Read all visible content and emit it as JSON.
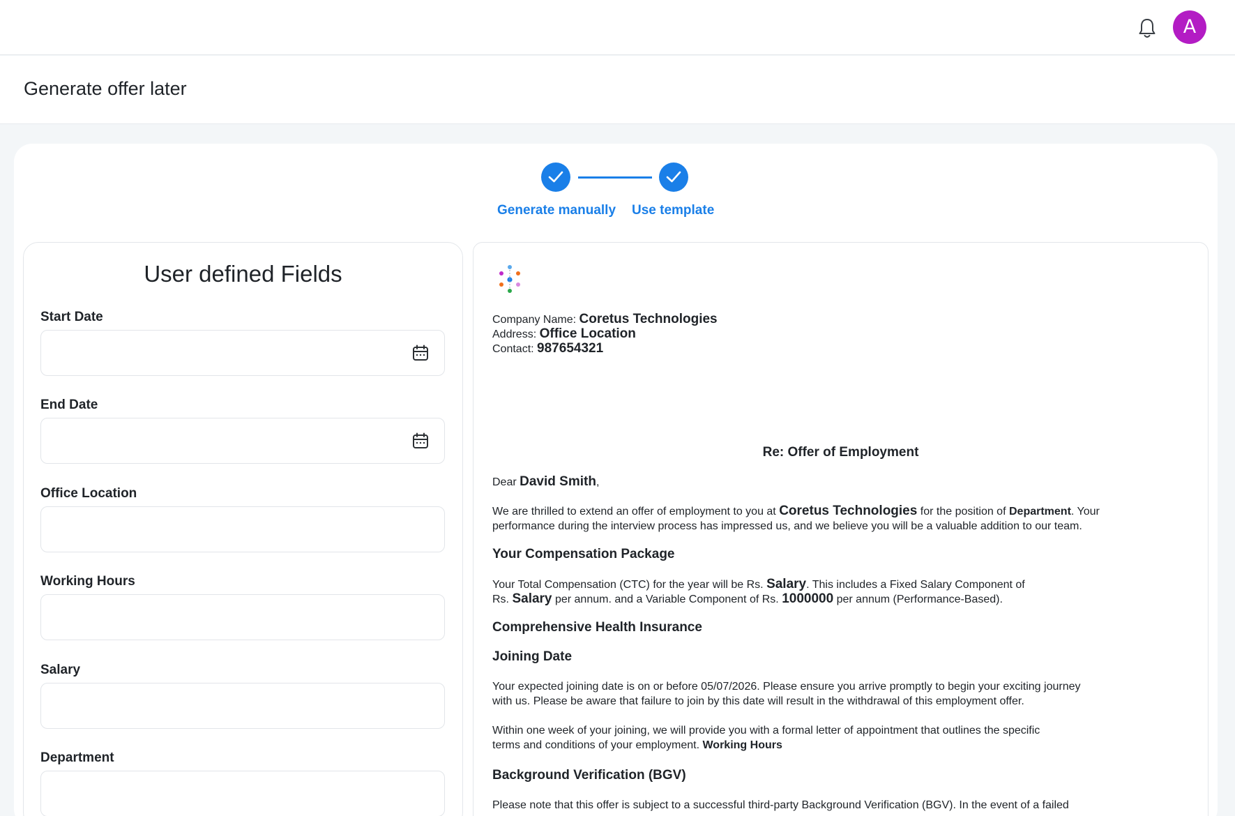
{
  "header": {
    "avatar_initial": "A",
    "bell_icon": "bell-icon"
  },
  "page": {
    "title": "Generate offer later"
  },
  "stepper": {
    "steps": [
      {
        "label": "Generate manually",
        "status": "completed"
      },
      {
        "label": "Use template",
        "status": "completed"
      }
    ],
    "accent": "#1a7fe8"
  },
  "form": {
    "title": "User defined Fields",
    "fields": [
      {
        "label": "Start Date",
        "value": "",
        "icon": "calendar-icon"
      },
      {
        "label": "End Date",
        "value": "",
        "icon": "calendar-icon"
      },
      {
        "label": "Office Location",
        "value": ""
      },
      {
        "label": "Working Hours",
        "value": ""
      },
      {
        "label": "Salary",
        "value": ""
      },
      {
        "label": "Department",
        "value": ""
      }
    ]
  },
  "letter": {
    "company_label": "Company Name:",
    "company_value": "Coretus Technologies",
    "address_label": "Address:",
    "address_value": "Office Location",
    "contact_label": "Contact:",
    "contact_value": "987654321",
    "subject": "Re: Offer of Employment",
    "greeting_prefix": "Dear",
    "candidate_name": "David Smith",
    "greeting_suffix": ",",
    "intro_1": "We are thrilled to extend an offer of employment to you at",
    "intro_company": "Coretus Technologies",
    "intro_2": "for the position of",
    "intro_position": "Department",
    "intro_3": ". Your",
    "intro_line2": "performance during the interview process has impressed us, and we believe you will be a valuable addition to our team.",
    "comp_heading": "Your Compensation Package",
    "comp_1": "Your Total Compensation (CTC) for the year will be Rs.",
    "comp_ctc": "Salary",
    "comp_2": ". This includes a Fixed Salary Component of",
    "comp_3": "Rs.",
    "comp_fixed": "Salary",
    "comp_4": "per annum. and a Variable Component of Rs.",
    "comp_variable": "1000000",
    "comp_5": "per annum (Performance-Based).",
    "health_heading": "Comprehensive Health Insurance",
    "joining_heading": "Joining Date",
    "joining_1": "Your expected joining date is on or before 05/07/2026. Please ensure you arrive promptly to begin your exciting journey",
    "joining_2": "with us. Please be aware that failure to join by this date will result in the withdrawal of this employment offer.",
    "appoint_1": "Within one week of your joining, we will provide you with a formal letter of appointment that outlines the specific",
    "appoint_2": "terms and conditions of your employment.",
    "appoint_hours": "Working Hours",
    "bgv_heading": "Background Verification (BGV)",
    "bgv_1": "Please note that this offer is subject to a successful third-party Background Verification (BGV). In the event of a failed"
  }
}
